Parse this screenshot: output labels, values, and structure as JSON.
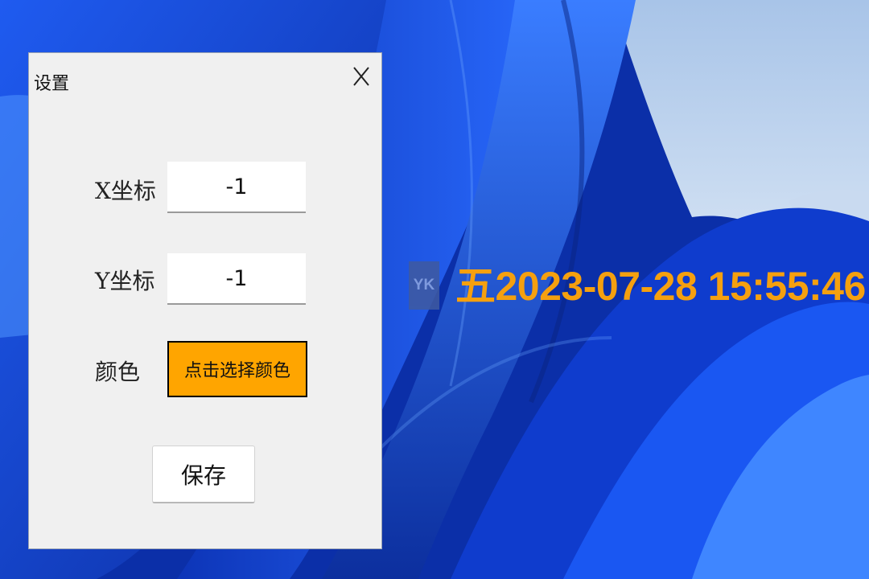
{
  "dialog": {
    "title": "设置",
    "close_label": "X",
    "fields": [
      {
        "label": "X坐标",
        "value": "-1"
      },
      {
        "label": "Y坐标",
        "value": "-1"
      }
    ],
    "color": {
      "label": "颜色",
      "button_label": "点击选择颜色",
      "swatch": "#ffa500"
    },
    "save_label": "保存"
  },
  "clock_widget": {
    "badge": "YK",
    "text": "五2023-07-28 15:55:46",
    "text_color": "#f5a00f"
  }
}
